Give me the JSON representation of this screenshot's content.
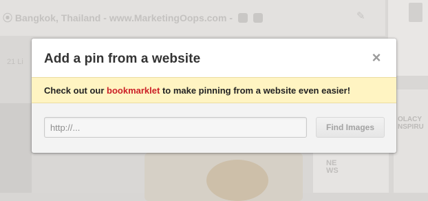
{
  "background": {
    "location": "Bangkok, Thailand",
    "website": "www.MarketingOops.com",
    "social_icons": [
      "twitter-icon",
      "facebook-icon"
    ],
    "count_label": "21 Li",
    "news_label": "NE\nWS",
    "right_label": "OLACY\nNSPIRU"
  },
  "modal": {
    "title": "Add a pin from a website",
    "close_icon": "close-icon",
    "notice": {
      "prefix": "Check out our ",
      "link": "bookmarklet",
      "suffix": " to make pinning from a website even easier!"
    },
    "url_input": {
      "value": "",
      "placeholder": "http://..."
    },
    "find_button_label": "Find Images"
  },
  "colors": {
    "notice_background": "#fff4c2",
    "link": "#cb2027",
    "overlay": "#d8d6d4"
  }
}
